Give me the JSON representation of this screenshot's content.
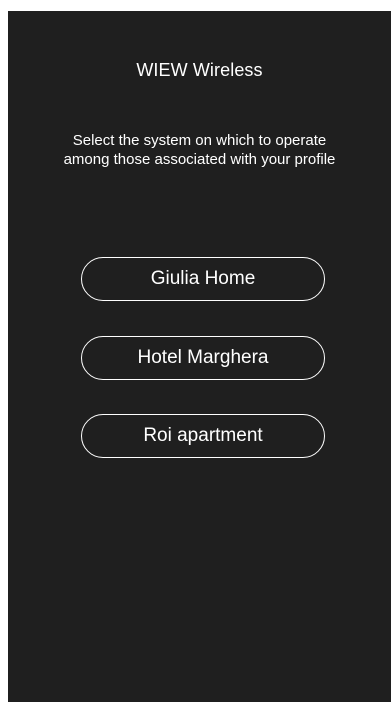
{
  "header": {
    "title": "WIEW Wireless"
  },
  "instructions": {
    "line1": "Select the system on which to operate",
    "line2": "among those associated with your profile"
  },
  "systems": [
    {
      "label": "Giulia Home"
    },
    {
      "label": "Hotel Marghera"
    },
    {
      "label": "Roi apartment"
    }
  ],
  "colors": {
    "background": "#1f1f1f",
    "text": "#ffffff",
    "button_border": "#ffffff"
  }
}
